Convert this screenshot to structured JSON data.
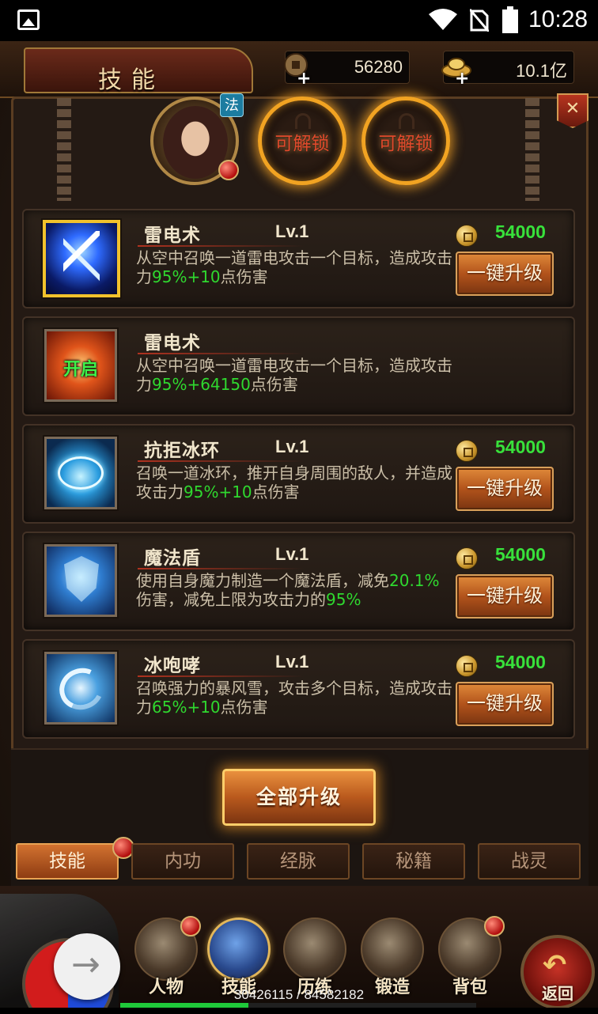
{
  "status_bar": {
    "time": "10:28"
  },
  "header": {
    "title": "技能",
    "copper": "56280",
    "gold": "10.1亿",
    "close_label": "✕"
  },
  "hero": {
    "class_badge": "法"
  },
  "unlock_slots": [
    {
      "label": "可解锁"
    },
    {
      "label": "可解锁"
    }
  ],
  "skills": [
    {
      "name": "雷电术",
      "level": "Lv.1",
      "desc_pre": "从空中召唤一道雷电攻击一个目标，造成攻击力",
      "desc_green": "95%+10",
      "desc_post": "点伤害",
      "cost": "54000",
      "button": "一键升级",
      "icon": "lightning-icon",
      "selected": true
    },
    {
      "name": "雷电术",
      "level": "",
      "desc_pre": "从空中召唤一道雷电攻击一个目标，造成攻击力",
      "desc_green": "95%+64150",
      "desc_post": "点伤害",
      "icon": "fire-beast-icon",
      "overlay": "开启"
    },
    {
      "name": "抗拒冰环",
      "level": "Lv.1",
      "desc_pre": "召唤一道冰环，推开自身周围的敌人，并造成攻击力",
      "desc_green": "95%+10",
      "desc_post": "点伤害",
      "cost": "54000",
      "button": "一键升级",
      "icon": "ice-ring-icon"
    },
    {
      "name": "魔法盾",
      "level": "Lv.1",
      "desc_pre": "使用自身魔力制造一个魔法盾，减免",
      "desc_green": "20.1%",
      "desc_mid": "伤害，减免上限为攻击力的",
      "desc_green2": "95%",
      "desc_post": "",
      "cost": "54000",
      "button": "一键升级",
      "icon": "magic-shield-icon"
    },
    {
      "name": "冰咆哮",
      "level": "Lv.1",
      "desc_pre": "召唤强力的暴风雪，攻击多个目标，造成攻击力",
      "desc_green": "65%+10",
      "desc_post": "点伤害",
      "cost": "54000",
      "button": "一键升级",
      "icon": "blizzard-icon"
    }
  ],
  "all_upgrade_label": "全部升级",
  "tabs": [
    {
      "label": "技能",
      "active": true
    },
    {
      "label": "内功"
    },
    {
      "label": "经脉"
    },
    {
      "label": "秘籍"
    },
    {
      "label": "战灵"
    }
  ],
  "nav": [
    {
      "label": "人物",
      "icon": "helmet-icon"
    },
    {
      "label": "技能",
      "icon": "skill-book-icon"
    },
    {
      "label": "历练",
      "icon": "armor-icon"
    },
    {
      "label": "锻造",
      "icon": "anvil-icon"
    },
    {
      "label": "背包",
      "icon": "bag-icon"
    }
  ],
  "back_label": "返回",
  "exp": {
    "text": "30426115 / 84582182",
    "fraction": 0.3597
  },
  "colors": {
    "accent_green": "#38e13b",
    "button_orange": "#b2531b",
    "glow_gold": "#f1a322"
  }
}
